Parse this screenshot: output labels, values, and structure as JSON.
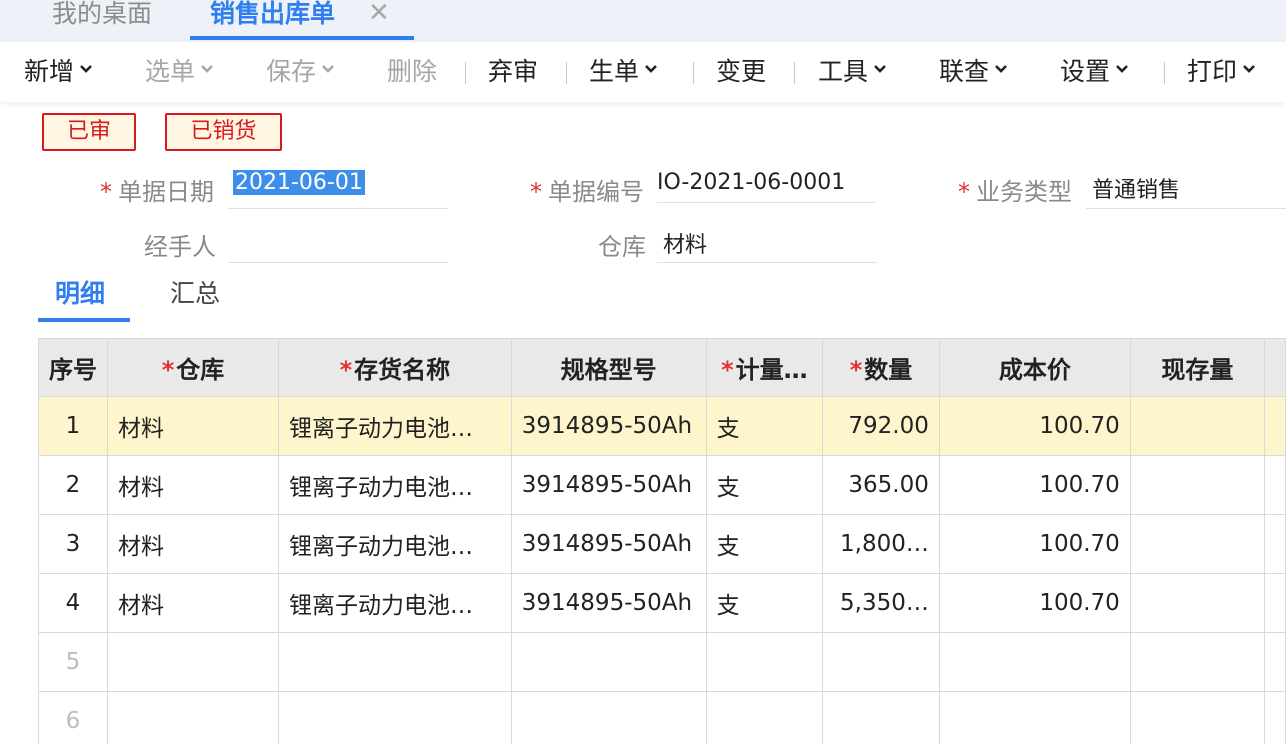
{
  "tabs": {
    "home": "我的桌面",
    "active": "销售出库单",
    "close": "✕"
  },
  "toolbar": {
    "add": "新增",
    "select_bill": "选单",
    "save": "保存",
    "delete": "删除",
    "abandon_review": "弃审",
    "generate_bill": "生单",
    "change": "变更",
    "tools": "工具",
    "linked_query": "联查",
    "settings": "设置",
    "print": "打印"
  },
  "badges": {
    "reviewed": "已审",
    "sold": "已销货"
  },
  "form": {
    "required_mark": "*",
    "bill_date_label": "单据日期",
    "bill_date_value": "2021-06-01",
    "bill_no_label": "单据编号",
    "bill_no_value": "IO-2021-06-0001",
    "biz_type_label": "业务类型",
    "biz_type_value": "普通销售",
    "handler_label": "经手人",
    "handler_value": "",
    "warehouse_label": "仓库",
    "warehouse_value": "材料"
  },
  "detail_tabs": {
    "detail": "明细",
    "summary": "汇总"
  },
  "grid": {
    "headers": {
      "index": "序号",
      "warehouse": "仓库",
      "item_name": "存货名称",
      "spec": "规格型号",
      "unit": "计量…",
      "qty": "数量",
      "cost": "成本价",
      "stock": "现存量"
    },
    "rows": [
      {
        "index": "1",
        "warehouse": "材料",
        "item_name": "锂离子动力电池…",
        "spec": "3914895-50Ah",
        "unit": "支",
        "qty": "792.00",
        "cost": "100.70",
        "stock": ""
      },
      {
        "index": "2",
        "warehouse": "材料",
        "item_name": "锂离子动力电池…",
        "spec": "3914895-50Ah",
        "unit": "支",
        "qty": "365.00",
        "cost": "100.70",
        "stock": ""
      },
      {
        "index": "3",
        "warehouse": "材料",
        "item_name": "锂离子动力电池…",
        "spec": "3914895-50Ah",
        "unit": "支",
        "qty": "1,800…",
        "cost": "100.70",
        "stock": ""
      },
      {
        "index": "4",
        "warehouse": "材料",
        "item_name": "锂离子动力电池…",
        "spec": "3914895-50Ah",
        "unit": "支",
        "qty": "5,350…",
        "cost": "100.70",
        "stock": ""
      }
    ],
    "empty_rows": [
      "5",
      "6"
    ]
  },
  "colors": {
    "accent": "#2f7ff0",
    "badge_red": "#d9191e",
    "selected_row": "#fff5cc"
  }
}
